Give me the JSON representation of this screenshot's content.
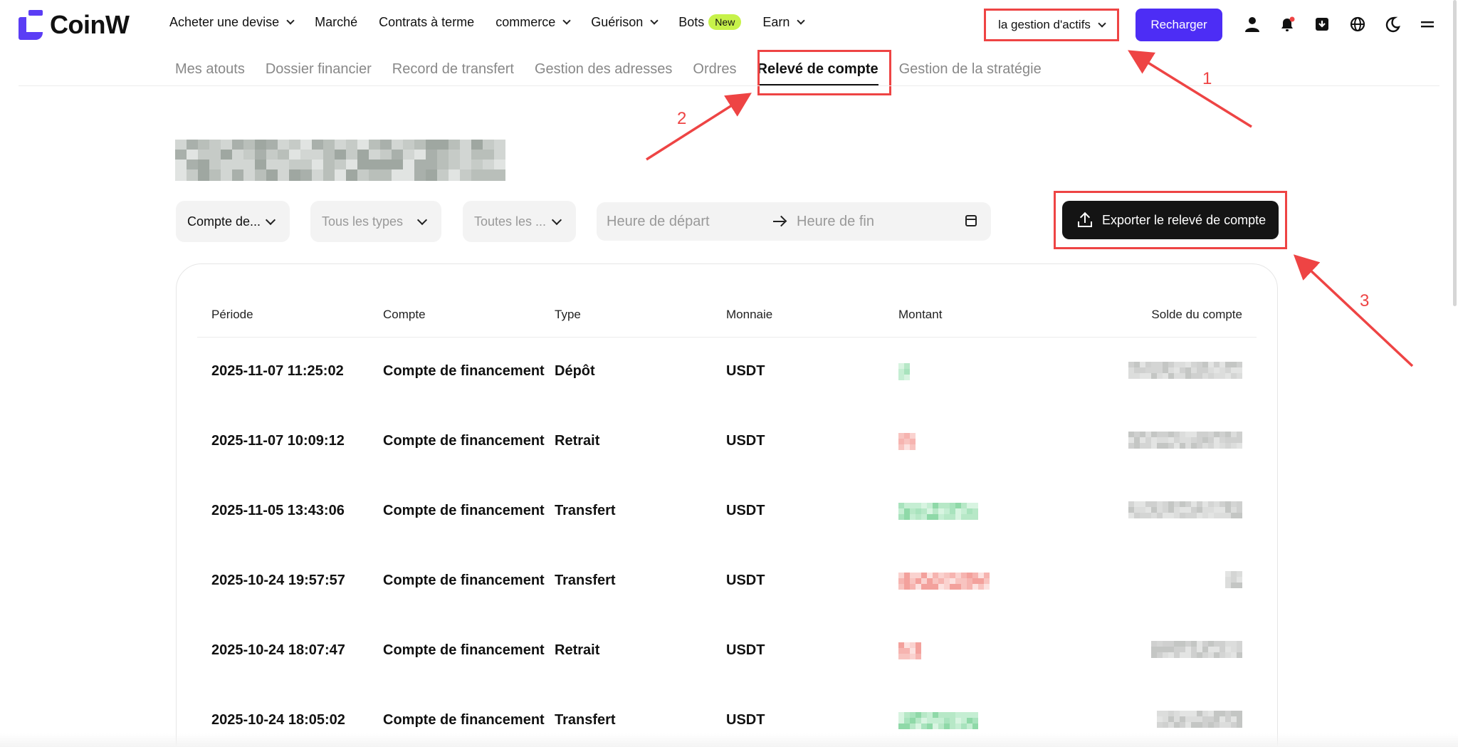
{
  "brand": {
    "name": "CoinW",
    "accent": "#5b3df5"
  },
  "nav": {
    "items": [
      {
        "label": "Acheter une devise",
        "dropdown": true
      },
      {
        "label": "Marché",
        "dropdown": false
      },
      {
        "label": "Contrats à terme",
        "dropdown": false
      },
      {
        "label": "commerce",
        "dropdown": true
      },
      {
        "label": "Guérison",
        "dropdown": true
      },
      {
        "label": "Bots",
        "dropdown": false,
        "badge": "New"
      },
      {
        "label": "Earn",
        "dropdown": true
      }
    ],
    "asset_management": "la gestion d'actifs",
    "recharge": "Recharger",
    "icons": [
      "user-icon",
      "bell-icon",
      "download-icon",
      "globe-icon",
      "moon-icon",
      "menu-icon"
    ]
  },
  "subtabs": [
    "Mes atouts",
    "Dossier financier",
    "Record de transfert",
    "Gestion des adresses",
    "Ordres",
    "Relevé de compte",
    "Gestion de la stratégie"
  ],
  "active_subtab": "Relevé de compte",
  "annotations": [
    "1",
    "2",
    "3"
  ],
  "filters": {
    "account": "Compte de...",
    "types": "Tous les types",
    "currencies": "Toutes les ...",
    "start_placeholder": "Heure de départ",
    "end_placeholder": "Heure de fin"
  },
  "export_button": "Exporter le relevé de compte",
  "table": {
    "headers": [
      "Période",
      "Compte",
      "Type",
      "Monnaie",
      "Montant",
      "Solde du compte"
    ],
    "rows": [
      {
        "period": "2025-11-07 11:25:02",
        "account": "Compte de financement",
        "type": "Dépôt",
        "currency": "USDT",
        "amount_tone": "positive"
      },
      {
        "period": "2025-11-07 10:09:12",
        "account": "Compte de financement",
        "type": "Retrait",
        "currency": "USDT",
        "amount_tone": "negative"
      },
      {
        "period": "2025-11-05 13:43:06",
        "account": "Compte de financement",
        "type": "Transfert",
        "currency": "USDT",
        "amount_tone": "positive"
      },
      {
        "period": "2025-10-24 19:57:57",
        "account": "Compte de financement",
        "type": "Transfert",
        "currency": "USDT",
        "amount_tone": "negative"
      },
      {
        "period": "2025-10-24 18:07:47",
        "account": "Compte de financement",
        "type": "Retrait",
        "currency": "USDT",
        "amount_tone": "negative"
      },
      {
        "period": "2025-10-24 18:05:02",
        "account": "Compte de financement",
        "type": "Transfert",
        "currency": "USDT",
        "amount_tone": "positive"
      }
    ]
  },
  "colors": {
    "highlight": "#ee4444",
    "positive": "#8fd9a8",
    "negative": "#f6b4b0",
    "redacted": "#c8cbc8"
  }
}
